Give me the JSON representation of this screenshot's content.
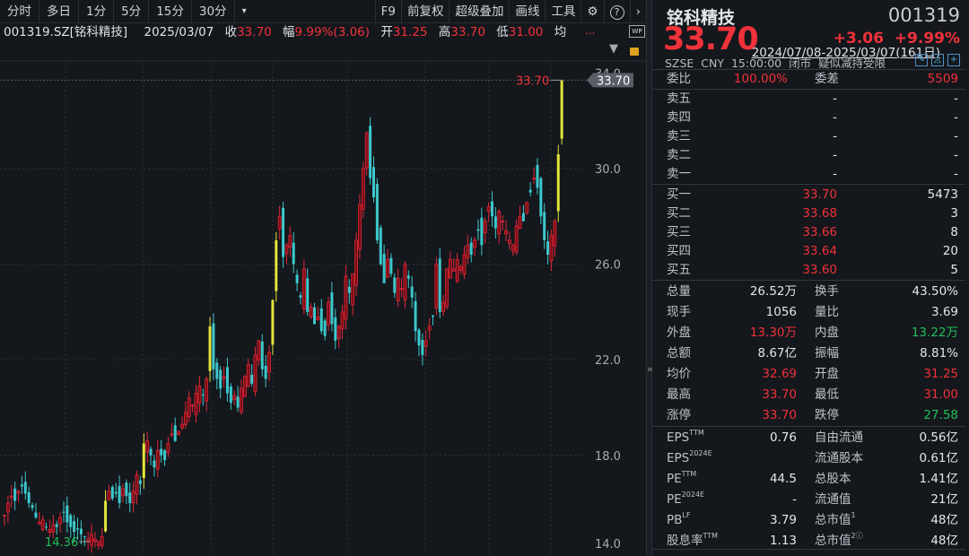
{
  "toolbar": {
    "tabs": [
      "分时",
      "多日",
      "1分",
      "5分",
      "15分",
      "30分"
    ],
    "more": "▾",
    "right": [
      "F9",
      "前复权",
      "超级叠加",
      "画线",
      "工具"
    ],
    "gear": "⚙",
    "help": "?",
    "next": "›"
  },
  "info": {
    "code": "001319.SZ[铭科精技]",
    "date": "2025/03/07",
    "close_label": "收",
    "close": "33.70",
    "amp_label": "幅",
    "amp": "9.99%(3.06)",
    "open_label": "开",
    "open": "31.25",
    "high_label": "高",
    "high": "33.70",
    "low_label": "低",
    "low": "31.00",
    "avg_label": "均",
    "more": "...",
    "wp": "WP"
  },
  "range": {
    "text": "2024/07/08-2025/03/07(161日)",
    "dropdown": "▼"
  },
  "chart_data": {
    "type": "candlestick",
    "ylim": [
      14,
      34
    ],
    "yticks": [
      "34.0",
      "30.0",
      "26.0",
      "22.0",
      "18.0",
      "14.0"
    ],
    "ytick_values": [
      34,
      30,
      26,
      22,
      18,
      14
    ],
    "max_label": "33.70",
    "min_label": "14.36",
    "last_price": "33.70",
    "closes": [
      15.5,
      16.0,
      16.3,
      16.1,
      16.5,
      16.7,
      16.4,
      16.0,
      15.8,
      15.4,
      15.2,
      15.3,
      15.0,
      14.9,
      15.1,
      15.0,
      15.4,
      15.6,
      15.2,
      15.0,
      14.8,
      14.9,
      14.7,
      14.6,
      14.5,
      14.7,
      14.5,
      14.4,
      14.6,
      16.1,
      16.5,
      16.2,
      16.4,
      16.0,
      16.6,
      16.3,
      16.0,
      16.5,
      17.2,
      16.8,
      18.5,
      18.6,
      18.0,
      17.5,
      18.2,
      18.0,
      17.8,
      18.5,
      18.9,
      18.6,
      19.0,
      19.3,
      19.8,
      20.4,
      20.1,
      20.6,
      20.9,
      20.5,
      21.2,
      23.4,
      21.6,
      21.2,
      20.8,
      21.3,
      20.6,
      20.2,
      20.5,
      20.0,
      20.8,
      21.3,
      21.8,
      21.0,
      22.2,
      22.8,
      21.6,
      21.2,
      22.3,
      24.5,
      27.0,
      28.0,
      26.3,
      26.8,
      27.2,
      26.0,
      25.2,
      24.6,
      25.8,
      24.0,
      24.2,
      23.5,
      23.8,
      23.2,
      23.0,
      24.4,
      23.5,
      22.8,
      23.4,
      24.0,
      25.5,
      24.8,
      25.6,
      27.0,
      28.5,
      30.0,
      31.5,
      29.6,
      28.8,
      27.0,
      26.0,
      25.2,
      26.2,
      25.6,
      24.8,
      25.4,
      25.0,
      26.0,
      25.4,
      24.6,
      23.2,
      22.6,
      22.2,
      22.8,
      23.4,
      23.8,
      26.0,
      24.0,
      24.4,
      25.8,
      26.2,
      25.8,
      26.2,
      25.9,
      26.4,
      26.8,
      26.4,
      27.0,
      27.4,
      26.8,
      27.8,
      28.4,
      28.0,
      27.5,
      28.2,
      27.8,
      27.4,
      27.0,
      26.8,
      27.6,
      28.0,
      27.8,
      28.6,
      29.0,
      29.6,
      29.2,
      28.0,
      27.0,
      26.4,
      27.2,
      27.8,
      30.6,
      33.7
    ]
  },
  "quote": {
    "name": "铭科精技",
    "code": "001319",
    "price": "33.70",
    "change": "+3.06",
    "pct": "+9.99%",
    "market": "SZSE",
    "currency": "CNY",
    "time": "15:00:00",
    "status": "闭市",
    "note": "疑似减持受限"
  },
  "ratio": {
    "l1": "委比",
    "v1": "100.00%",
    "l2": "委差",
    "v2": "5509"
  },
  "asks": [
    {
      "label": "卖五",
      "price": "-",
      "vol": "-"
    },
    {
      "label": "卖四",
      "price": "-",
      "vol": "-"
    },
    {
      "label": "卖三",
      "price": "-",
      "vol": "-"
    },
    {
      "label": "卖二",
      "price": "-",
      "vol": "-"
    },
    {
      "label": "卖一",
      "price": "-",
      "vol": "-"
    }
  ],
  "bids": [
    {
      "label": "买一",
      "price": "33.70",
      "vol": "5473"
    },
    {
      "label": "买二",
      "price": "33.68",
      "vol": "3"
    },
    {
      "label": "买三",
      "price": "33.66",
      "vol": "8"
    },
    {
      "label": "买四",
      "price": "33.64",
      "vol": "20"
    },
    {
      "label": "买五",
      "price": "33.60",
      "vol": "5"
    }
  ],
  "stats": [
    {
      "l1": "总量",
      "v1": "26.52万",
      "c1": "white",
      "l2": "换手",
      "v2": "43.50%",
      "c2": "white"
    },
    {
      "l1": "现手",
      "v1": "1056",
      "c1": "white",
      "l2": "量比",
      "v2": "3.69",
      "c2": "white"
    },
    {
      "l1": "外盘",
      "v1": "13.30万",
      "c1": "red",
      "l2": "内盘",
      "v2": "13.22万",
      "c2": "green"
    },
    {
      "l1": "总额",
      "v1": "8.67亿",
      "c1": "white",
      "l2": "振幅",
      "v2": "8.81%",
      "c2": "white"
    },
    {
      "l1": "均价",
      "v1": "32.69",
      "c1": "red",
      "l2": "开盘",
      "v2": "31.25",
      "c2": "red"
    },
    {
      "l1": "最高",
      "v1": "33.70",
      "c1": "red",
      "l2": "最低",
      "v2": "31.00",
      "c2": "red"
    },
    {
      "l1": "涨停",
      "v1": "33.70",
      "c1": "red",
      "l2": "跌停",
      "v2": "27.58",
      "c2": "green"
    }
  ],
  "fund": [
    {
      "l1": "EPS",
      "s1": "TTM",
      "v1": "0.76",
      "l2": "自由流通",
      "s2": "",
      "v2": "0.56亿"
    },
    {
      "l1": "EPS",
      "s1": "2024E",
      "v1": "",
      "l2": "流通股本",
      "s2": "",
      "v2": "0.61亿"
    },
    {
      "l1": "PE",
      "s1": "TTM",
      "v1": "44.5",
      "l2": "总股本",
      "s2": "",
      "v2": "1.41亿"
    },
    {
      "l1": "PE",
      "s1": "2024E",
      "v1": "-",
      "l2": "流通值",
      "s2": "",
      "v2": "21亿"
    },
    {
      "l1": "PB",
      "s1": "LF",
      "v1": "3.79",
      "l2": "总市值",
      "s2": "1",
      "v2": "48亿"
    },
    {
      "l1": "股息率",
      "s1": "TTM",
      "v1": "1.13",
      "l2": "总市值",
      "s2": "2ⓘ",
      "v2": "48亿"
    }
  ],
  "divider": {
    "toggle": "»"
  },
  "colors": {
    "up": "#e0283a",
    "down": "#3cc8cc",
    "limit": "#e4e43a",
    "bg": "#14171c"
  }
}
